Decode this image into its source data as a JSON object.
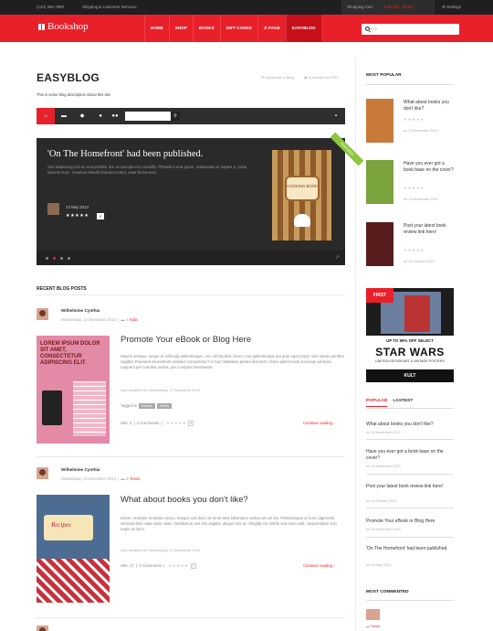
{
  "topbar": {
    "phone": "(123) 456-7890",
    "shipping": "Shipping & Customer Services",
    "cart_label": "Shopping Cart",
    "cart_items": "0 item(s) - $0.00",
    "settings": "Settings"
  },
  "header": {
    "logo": "Bookshop",
    "search_placeholder": "Search"
  },
  "nav": [
    {
      "label": "HOME"
    },
    {
      "label": "SHOP"
    },
    {
      "label": "BOOKS"
    },
    {
      "label": "GIFT CARDS"
    },
    {
      "label": "J! PAGE"
    },
    {
      "label": "EASYBLOG"
    }
  ],
  "blog": {
    "title": "EASYBLOG",
    "description": "This is some blog description about this site",
    "subscribe": "Subscribe to Blog",
    "subscribe_rss": "Subscribe via RSS"
  },
  "featured": {
    "title": "'On The Homefront' had been published.",
    "description": "Sed adipiscing nisl ac erat porttitor dui, ut suscipit est convallis. Phasellus erat quam, malesuada et sapien a, porta lobortis nunc. Vivamus blandit interdum tortor, vitae fermentum.",
    "date": "13 May 2013",
    "comments": "0",
    "ribbon": "FEATURED",
    "book_label": "COOKING BOOK"
  },
  "recent_heading": "RECENT BLOG POSTS",
  "posts": [
    {
      "author": "Wilhelmine Cynthia",
      "date": "Wednesday, 13 November 2013",
      "in": "in",
      "category": "Kids",
      "title": "Promote Your eBook or Blog Here",
      "body": "Mauris semper, neque et vehicula pellentesque, orci nisl facilisis lorem, non pellentesque dui ante eget turpis. Sed varius porttitor sagittis! Praesent elementum sodales consectetur? In hac habitasse platea dictumst. Class aptent taciti sociosqu ad litora torquent per conubia nostra, per inceptos himenaeos.",
      "last_modified": "Last modified on Wednesday, 11 December 2013",
      "tagged_label": "Tagged in",
      "tags": [
        "Novels",
        "Teens"
      ],
      "hits": "Hits: 4",
      "comments": "0 Comments",
      "rating_count": "0",
      "continue": "Continue reading",
      "image_text": "LOREM IPSUM DOLOR SIT AMET, CONSECTETUR ADIPISCING ELIT"
    },
    {
      "author": "Wilhelmine Cynthia",
      "date": "Wednesday, 13 November 2013",
      "in": "in",
      "category": "Teens",
      "title": "What about books you don't like?",
      "body": "Donec molestie molestie varius. Integer sed dolor sit amet ante bibendum varius vel vel dui. Pellentesque id nunc dignissim, vehicula felis vitae dolor vitae. Vestibulum sed nisi sagittis, aliquet nisi ac, fringilla est. Morbi sed enim velit. Suspendisse non turpis ut dolor.",
      "last_modified": "Last modified on Wednesday, 11 December 2013",
      "hits": "Hits: 17",
      "comments": "0 Comments",
      "rating_count": "0",
      "continue": "Continue reading",
      "image_text": "Recipes"
    }
  ],
  "sidebar": {
    "most_popular": "MOST POPULAR",
    "popular_items": [
      {
        "title": "What about books you don't like?",
        "date": "on 13 November 2013"
      },
      {
        "title": "Have you ever got a book base on the cover?",
        "date": "on 13 November 2013"
      },
      {
        "title": "Post your latest book review link here!",
        "date": "on 10 October 2013"
      }
    ],
    "ad": {
      "top": "FIRST",
      "line1": "UP TO 95% OFF SELECT",
      "line2": "STAR WARS",
      "line3": "LIMITED EDITION ART & VINTAGE POSTERS",
      "line4": "KULT"
    },
    "tab_popular": "POPULAR",
    "tab_latest": "LASTEST",
    "latest_items": [
      {
        "title": "What about books you don't like?",
        "date": "on 13 November 2013"
      },
      {
        "title": "Have you ever got a book base on the cover?",
        "date": "on 13 November 2013"
      },
      {
        "title": "Post your latest book review link here!",
        "date": "on 10 October 2013"
      },
      {
        "title": "Promote Your eBook or Blog Here",
        "date": "on 13 November 2013"
      },
      {
        "title": "'On The Homefront' had been published.",
        "date": "on 13 May 2013"
      }
    ],
    "most_commented": "MOST COMMENTED",
    "commented_cat": "Teens"
  },
  "colors": {
    "accent": "#e8202a",
    "dark": "#2e2e2e"
  }
}
